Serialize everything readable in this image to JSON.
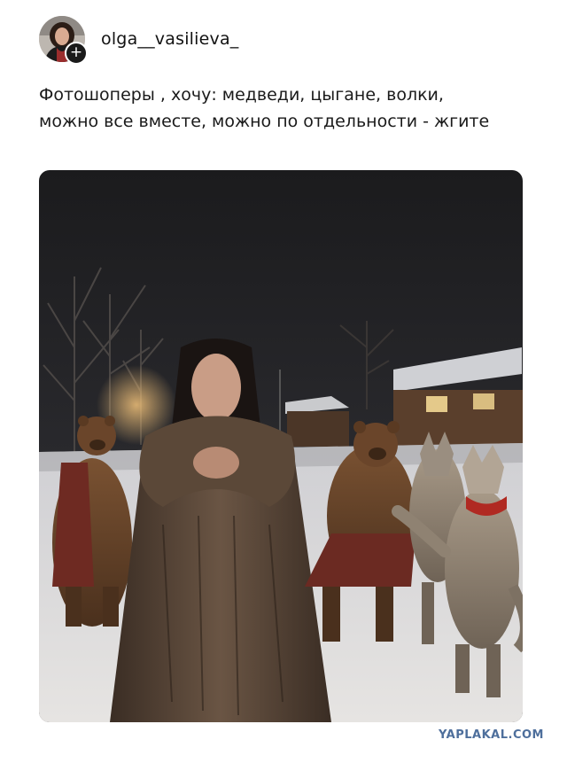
{
  "post": {
    "username": "olga__vasilieva_",
    "follow_symbol": "+",
    "caption_lines": [
      "Фотошоперы , хочу: медведи, цыгане, волки,",
      "можно все вместе, можно по отдельности - жгите"
    ]
  },
  "watermark": "YAPLAKAL.COM",
  "colors": {
    "text": "#1a1a1a",
    "watermark": "#4e6f9c",
    "follow_button": "#1a1a1a"
  },
  "icons": {
    "follow": "plus-icon"
  }
}
